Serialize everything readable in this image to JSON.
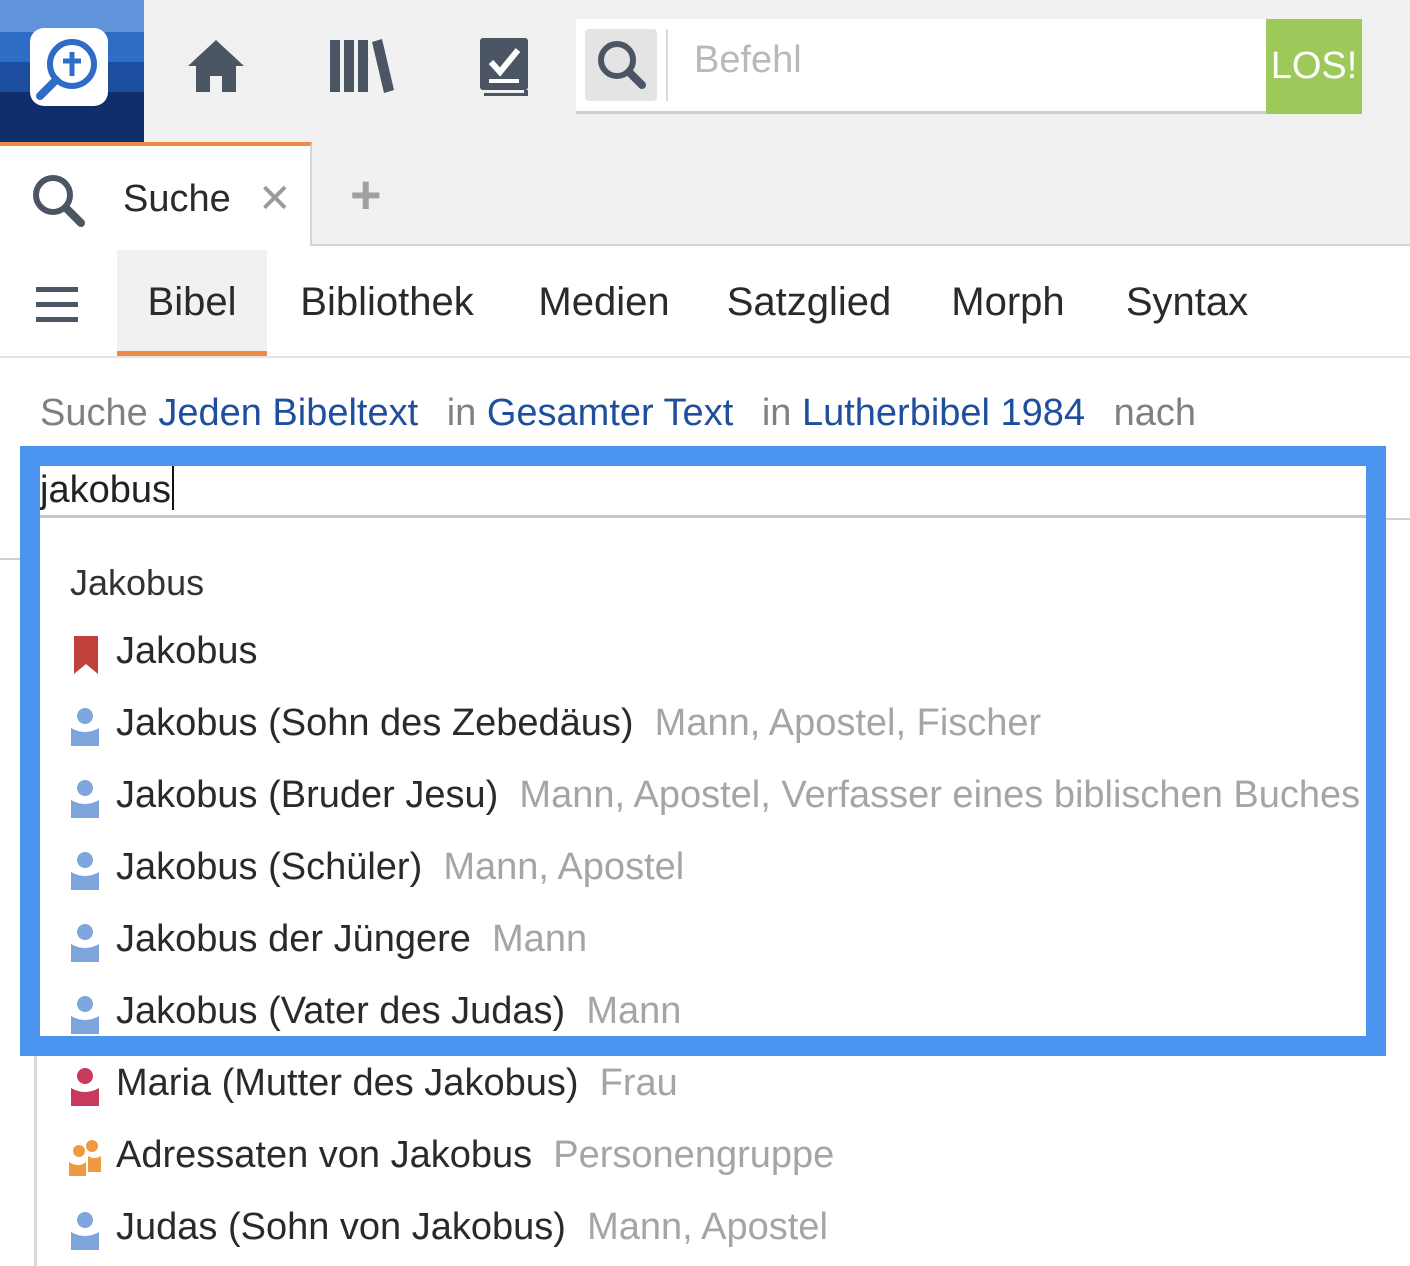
{
  "toolbar": {
    "logo_icon": "logos-search-logo",
    "home_icon": "home-icon",
    "library_icon": "library-icon",
    "checklist_icon": "checklist-icon",
    "command_placeholder": "Befehl",
    "go_label": "LOS!"
  },
  "tabs": {
    "active_label": "Suche",
    "close_symbol": "✕",
    "add_symbol": "+"
  },
  "subnav": {
    "items": [
      "Bibel",
      "Bibliothek",
      "Medien",
      "Satzglied",
      "Morph",
      "Syntax"
    ],
    "active": "Bibel"
  },
  "search_line": {
    "prefix": "Suche",
    "scope": "Jeden Bibeltext",
    "in1": "in",
    "range": "Gesamter Text",
    "in2": "in",
    "bible": "Lutherbibel 1984",
    "suffix": "nach"
  },
  "query": "jakobus",
  "dropdown": {
    "heading": "Jakobus",
    "items": [
      {
        "name": "Jakobus",
        "desc": "",
        "icon": "bookmark-icon"
      },
      {
        "name": "Jakobus (Sohn des Zebedäus)",
        "desc": "Mann, Apostel, Fischer",
        "icon": "person-male-icon"
      },
      {
        "name": "Jakobus (Bruder Jesu)",
        "desc": "Mann, Apostel, Verfasser eines biblischen Buches",
        "icon": "person-male-icon"
      },
      {
        "name": "Jakobus (Schüler)",
        "desc": "Mann, Apostel",
        "icon": "person-male-icon"
      },
      {
        "name": "Jakobus der Jüngere",
        "desc": "Mann",
        "icon": "person-male-icon"
      },
      {
        "name": "Jakobus (Vater des Judas)",
        "desc": "Mann",
        "icon": "person-male-icon"
      },
      {
        "name": "Maria (Mutter des Jakobus)",
        "desc": "Frau",
        "icon": "person-female-icon"
      },
      {
        "name": "Adressaten von Jakobus",
        "desc": "Personengruppe",
        "icon": "person-group-icon"
      },
      {
        "name": "Judas (Sohn von Jakobus)",
        "desc": "Mann, Apostel",
        "icon": "person-male-icon"
      }
    ]
  },
  "colors": {
    "accent_orange": "#ed8b47",
    "highlight_blue": "#4a94f0",
    "link_blue": "#1f4f9c",
    "go_green": "#9dc95a",
    "bookmark_red": "#c0403b",
    "male_blue": "#7ea6dc",
    "female_red": "#c73a5e",
    "group_orange": "#ef9a40"
  }
}
